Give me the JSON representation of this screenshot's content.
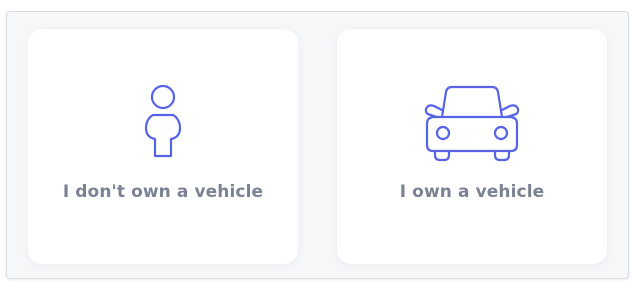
{
  "options": [
    {
      "label": "I don't own a vehicle",
      "icon": "person-icon"
    },
    {
      "label": "I own a vehicle",
      "icon": "car-icon"
    }
  ],
  "colors": {
    "icon_stroke": "#5663e6",
    "label_text": "#7b8294",
    "card_background": "#ffffff",
    "panel_background": "#f6f7f9"
  }
}
